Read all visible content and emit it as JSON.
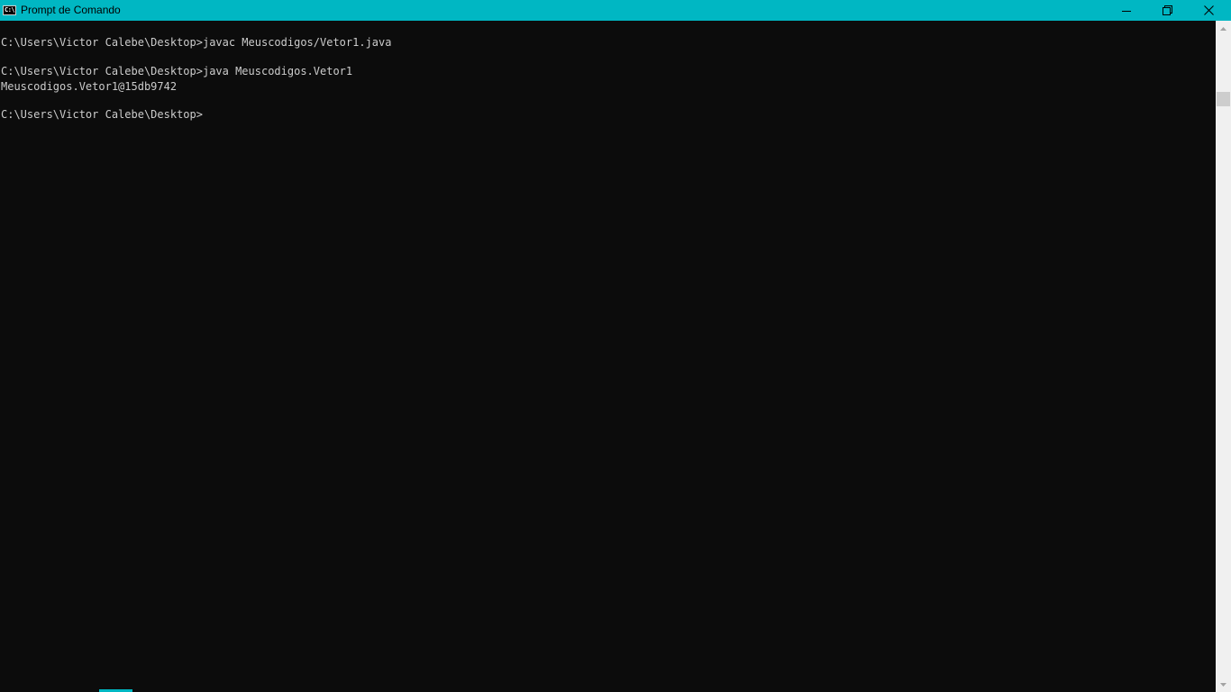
{
  "window": {
    "title": "Prompt de Comando",
    "app_icon_label": "C:\\.",
    "accent_color": "#00b7c3",
    "console_background": "#0c0c0c",
    "console_foreground": "#cccccc"
  },
  "controls": {
    "minimize_icon": "minimize-icon",
    "restore_icon": "restore-icon",
    "close_icon": "close-icon"
  },
  "console": {
    "lines": [
      "C:\\Users\\Victor Calebe\\Desktop>javac Meuscodigos/Vetor1.java",
      "C:\\Users\\Victor Calebe\\Desktop>java Meuscodigos.Vetor1",
      "Meuscodigos.Vetor1@15db9742",
      "C:\\Users\\Victor Calebe\\Desktop>"
    ]
  },
  "scrollbar": {
    "up_icon": "arrow-up-icon",
    "down_icon": "arrow-down-icon"
  }
}
